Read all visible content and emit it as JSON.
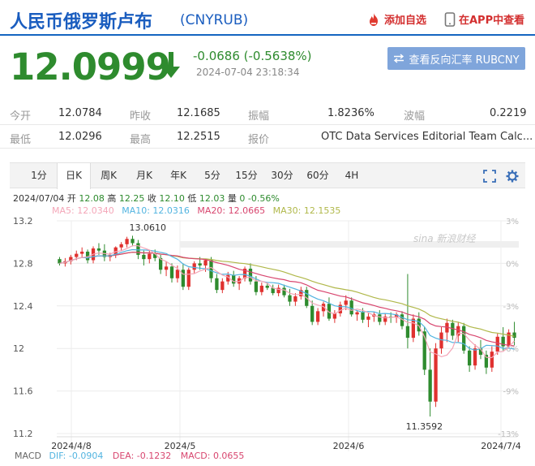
{
  "header": {
    "title": "人民币俄罗斯卢布",
    "code": "(CNYRUB)",
    "add_favorite": "添加自选",
    "open_app": "在APP中查看"
  },
  "quote": {
    "price": "12.0999",
    "change": "-0.0686 (-0.5638%)",
    "time": "2024-07-04 23:18:34",
    "reverse_button": "查看反向汇率 RUBCNY"
  },
  "stats": {
    "row1": [
      {
        "label": "今开",
        "value": "12.0784"
      },
      {
        "label": "昨收",
        "value": "12.1685"
      },
      {
        "label": "振幅",
        "value": "1.8236%"
      },
      {
        "label": "波幅",
        "value": "0.2219"
      }
    ],
    "row2": [
      {
        "label": "最低",
        "value": "12.0296"
      },
      {
        "label": "最高",
        "value": "12.2515"
      },
      {
        "label": "报价",
        "value": "OTC Data Services Editorial Team Calc..."
      }
    ]
  },
  "chart_tabs": [
    "1分",
    "日K",
    "周K",
    "月K",
    "年K",
    "5分",
    "15分",
    "30分",
    "60分",
    "4H"
  ],
  "active_tab": "日K",
  "ohlc_line": {
    "date": "2024/07/04",
    "open_label": "开",
    "open": "12.08",
    "high_label": "高",
    "high": "12.25",
    "close_label": "收",
    "close": "12.10",
    "low_label": "低",
    "low": "12.03",
    "vol_label": "量",
    "vol": "0",
    "pct": "-0.56%"
  },
  "ma_line": {
    "ma5": "MA5: 12.0340",
    "ma10": "MA10: 12.0316",
    "ma20": "MA20: 12.0665",
    "ma30": "MA30: 12.1535"
  },
  "macd_line": {
    "label": "MACD",
    "dif": "DIF: -0.0904",
    "dea": "DEA: -0.1232",
    "macd": "MACD: 0.0655"
  },
  "watermark": "sina 新浪财经",
  "colors": {
    "up": "#e0312f",
    "down": "#2e8b2e",
    "ma5": "#f4a6b8",
    "ma10": "#52b4e0",
    "ma20": "#d8466f",
    "ma30": "#b0b84a",
    "accent": "#1a5dbf"
  },
  "chart_data": {
    "type": "candlestick",
    "title": "",
    "y_ticks": [
      "13.2",
      "12.8",
      "12.4",
      "12",
      "11.6",
      "11.2"
    ],
    "y_range": [
      11.2,
      13.2
    ],
    "pct_ticks": [
      "3%",
      "0%",
      "-3%",
      "-6%",
      "-9%",
      "-13%"
    ],
    "x_labels": [
      "2024/4/8",
      "2024/5",
      "2024/6",
      "2024/7/4"
    ],
    "annotations": [
      {
        "text": "13.0610",
        "value": 13.061
      },
      {
        "text": "11.3592",
        "value": 11.3592
      }
    ],
    "candles": [
      [
        12.84,
        12.86,
        12.78,
        12.8
      ],
      [
        12.8,
        12.85,
        12.77,
        12.82
      ],
      [
        12.82,
        12.88,
        12.79,
        12.86
      ],
      [
        12.86,
        12.92,
        12.83,
        12.89
      ],
      [
        12.89,
        12.95,
        12.85,
        12.91
      ],
      [
        12.91,
        12.93,
        12.8,
        12.83
      ],
      [
        12.83,
        12.96,
        12.8,
        12.94
      ],
      [
        12.94,
        12.99,
        12.88,
        12.92
      ],
      [
        12.92,
        12.98,
        12.82,
        12.86
      ],
      [
        12.86,
        12.9,
        12.82,
        12.88
      ],
      [
        12.88,
        12.96,
        12.85,
        12.95
      ],
      [
        12.95,
        13.0,
        12.92,
        12.98
      ],
      [
        12.98,
        13.05,
        12.95,
        13.03
      ],
      [
        13.03,
        13.06,
        12.96,
        12.99
      ],
      [
        12.99,
        13.02,
        12.84,
        12.88
      ],
      [
        12.88,
        12.92,
        12.78,
        12.84
      ],
      [
        12.84,
        12.92,
        12.8,
        12.89
      ],
      [
        12.89,
        12.93,
        12.82,
        12.85
      ],
      [
        12.85,
        12.88,
        12.7,
        12.74
      ],
      [
        12.74,
        12.82,
        12.68,
        12.77
      ],
      [
        12.77,
        12.8,
        12.62,
        12.66
      ],
      [
        12.66,
        12.78,
        12.62,
        12.74
      ],
      [
        12.74,
        12.8,
        12.55,
        12.58
      ],
      [
        12.58,
        12.76,
        12.55,
        12.74
      ],
      [
        12.74,
        12.82,
        12.7,
        12.8
      ],
      [
        12.8,
        12.86,
        12.74,
        12.78
      ],
      [
        12.78,
        12.84,
        12.72,
        12.83
      ],
      [
        12.83,
        12.86,
        12.62,
        12.66
      ],
      [
        12.66,
        12.7,
        12.52,
        12.55
      ],
      [
        12.55,
        12.66,
        12.52,
        12.63
      ],
      [
        12.63,
        12.72,
        12.6,
        12.69
      ],
      [
        12.69,
        12.73,
        12.58,
        12.61
      ],
      [
        12.61,
        12.68,
        12.55,
        12.66
      ],
      [
        12.66,
        12.77,
        12.63,
        12.75
      ],
      [
        12.75,
        12.8,
        12.6,
        12.63
      ],
      [
        12.63,
        12.68,
        12.5,
        12.53
      ],
      [
        12.53,
        12.62,
        12.5,
        12.59
      ],
      [
        12.59,
        12.62,
        12.55,
        12.57
      ],
      [
        12.57,
        12.6,
        12.5,
        12.52
      ],
      [
        12.52,
        12.6,
        12.49,
        12.57
      ],
      [
        12.57,
        12.6,
        12.48,
        12.5
      ],
      [
        12.5,
        12.56,
        12.4,
        12.44
      ],
      [
        12.44,
        12.52,
        12.4,
        12.49
      ],
      [
        12.49,
        12.58,
        12.46,
        12.55
      ],
      [
        12.55,
        12.58,
        12.38,
        12.4
      ],
      [
        12.4,
        12.45,
        12.22,
        12.25
      ],
      [
        12.25,
        12.38,
        12.22,
        12.35
      ],
      [
        12.35,
        12.44,
        12.3,
        12.42
      ],
      [
        12.42,
        12.48,
        12.26,
        12.28
      ],
      [
        12.28,
        12.36,
        12.24,
        12.33
      ],
      [
        12.33,
        12.44,
        12.3,
        12.41
      ],
      [
        12.41,
        12.5,
        12.36,
        12.45
      ],
      [
        12.45,
        12.48,
        12.3,
        12.32
      ],
      [
        12.32,
        12.36,
        12.26,
        12.34
      ],
      [
        12.34,
        12.38,
        12.24,
        12.27
      ],
      [
        12.27,
        12.33,
        12.2,
        12.3
      ],
      [
        12.3,
        12.34,
        12.25,
        12.32
      ],
      [
        12.32,
        12.36,
        12.22,
        12.25
      ],
      [
        12.25,
        12.33,
        12.22,
        12.3
      ],
      [
        12.3,
        12.34,
        12.24,
        12.29
      ],
      [
        12.29,
        12.34,
        12.24,
        12.32
      ],
      [
        12.32,
        12.35,
        12.18,
        12.21
      ],
      [
        12.21,
        12.7,
        12.0,
        12.1
      ],
      [
        12.1,
        12.32,
        12.06,
        12.28
      ],
      [
        12.28,
        12.34,
        12.12,
        12.16
      ],
      [
        12.16,
        12.2,
        11.75,
        11.8
      ],
      [
        11.8,
        12.0,
        11.36,
        11.5
      ],
      [
        11.5,
        12.05,
        11.45,
        12.0
      ],
      [
        12.0,
        12.2,
        11.95,
        12.15
      ],
      [
        12.15,
        12.28,
        12.06,
        12.24
      ],
      [
        12.24,
        12.27,
        12.08,
        12.12
      ],
      [
        12.12,
        12.25,
        12.06,
        12.21
      ],
      [
        12.21,
        12.24,
        11.95,
        11.98
      ],
      [
        11.98,
        12.02,
        11.78,
        11.84
      ],
      [
        11.84,
        12.04,
        11.8,
        12.0
      ],
      [
        12.0,
        12.08,
        11.9,
        11.94
      ],
      [
        11.94,
        11.98,
        11.76,
        11.82
      ],
      [
        11.82,
        12.02,
        11.78,
        11.97
      ],
      [
        11.97,
        12.14,
        11.94,
        12.11
      ],
      [
        12.11,
        12.2,
        11.98,
        12.02
      ],
      [
        12.02,
        12.18,
        12.0,
        12.15
      ],
      [
        12.15,
        12.25,
        12.03,
        12.1
      ]
    ]
  }
}
